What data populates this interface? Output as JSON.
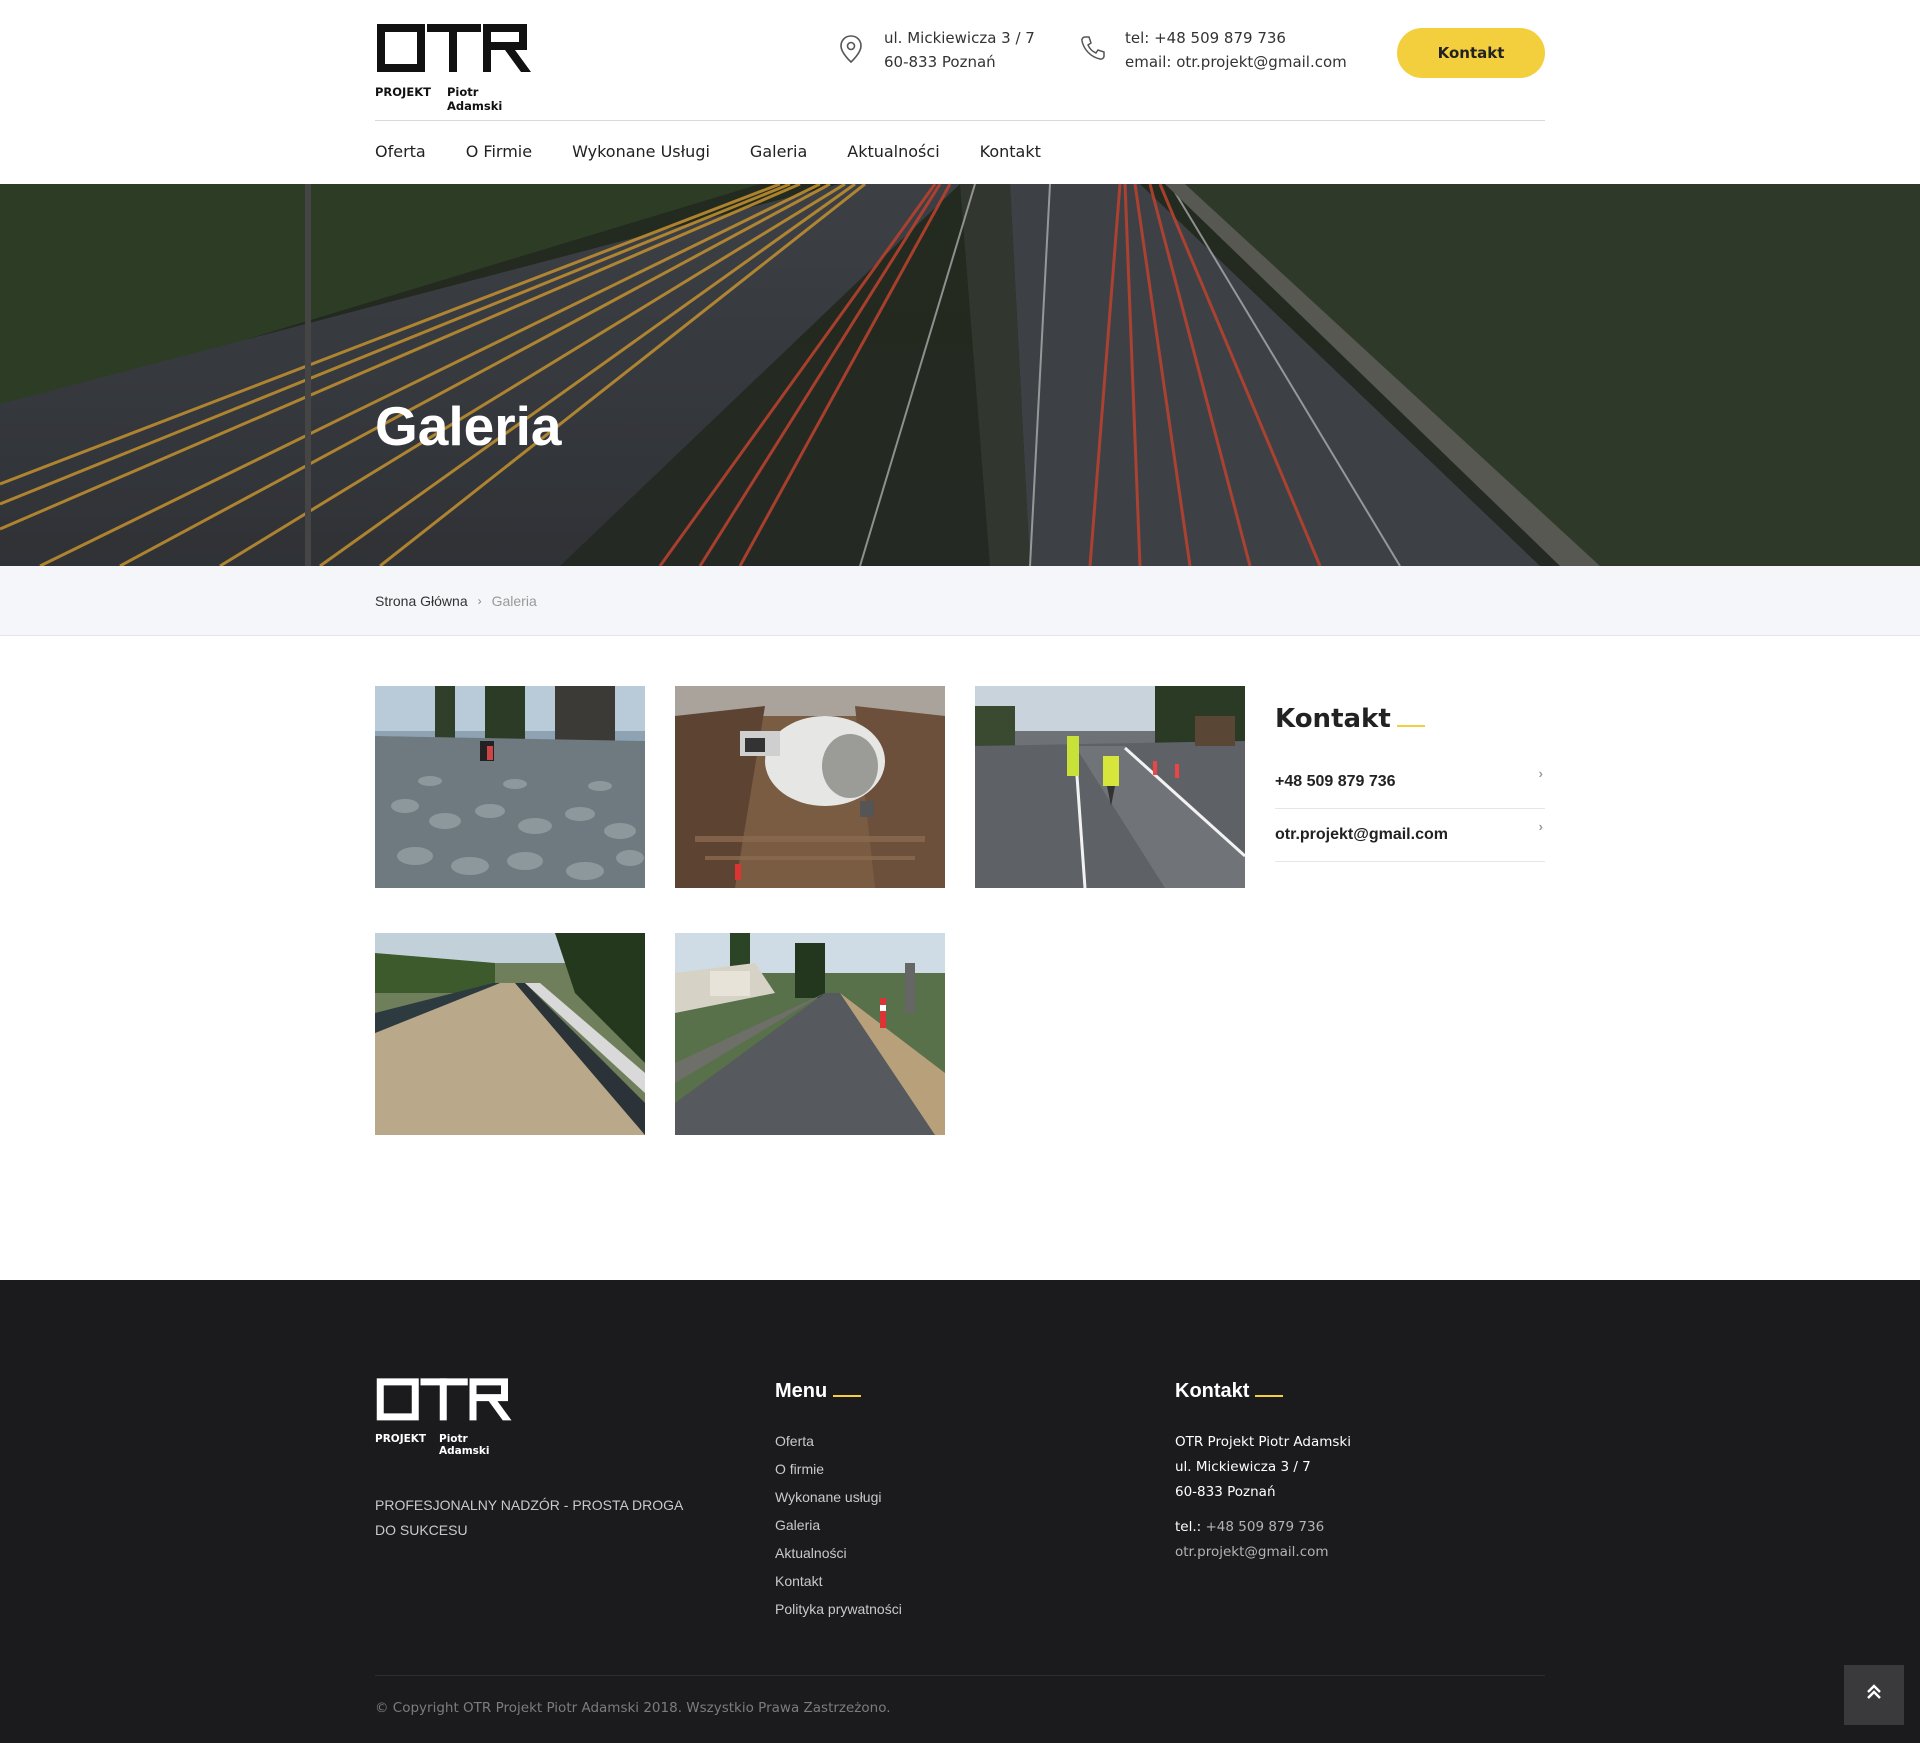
{
  "logo": {
    "mark": "OTR",
    "left": "PROJEKT",
    "right": "Piotr Adamski"
  },
  "header": {
    "address_line1": "ul. Mickiewicza 3 / 7",
    "address_line2": "60-833 Poznań",
    "phone_line": "tel: +48 509 879 736",
    "email_line": "email: otr.projekt@gmail.com",
    "cta_label": "Kontakt",
    "location_icon": "map-pin-icon",
    "phone_icon": "phone-icon",
    "accent": "#f4cf3d"
  },
  "nav": {
    "items": [
      "Oferta",
      "O Firmie",
      "Wykonane Usługi",
      "Galeria",
      "Aktualności",
      "Kontakt"
    ]
  },
  "hero": {
    "title": "Galeria"
  },
  "breadcrumb": {
    "home": "Strona Główna",
    "current": "Galeria"
  },
  "gallery": {
    "images": [
      "cobblestone-road-photo",
      "excavation-pipe-photo",
      "road-workers-photo",
      "new-asphalt-road-photo",
      "paved-street-photo"
    ]
  },
  "sidebar": {
    "title": "Kontakt",
    "phone": "+48 509 879 736",
    "email": "otr.projekt@gmail.com"
  },
  "footer": {
    "slogan": "PROFESJONALNY NADZÓR - PROSTA DROGA DO SUKCESU",
    "menu_title": "Menu",
    "menu": [
      "Oferta",
      "O firmie",
      "Wykonane usługi",
      "Galeria",
      "Aktualności",
      "Kontakt",
      "Polityka prywatności"
    ],
    "contact_title": "Kontakt",
    "company": "OTR Projekt Piotr Adamski",
    "address_line1": "ul. Mickiewicza 3 / 7",
    "address_line2": "60-833 Poznań",
    "tel_label": "tel.:",
    "tel": "+48 509 879 736",
    "email": "otr.projekt@gmail.com",
    "copyright": "© Copyright OTR Projekt Piotr Adamski 2018. Wszystkio Prawa Zastrzeżono.",
    "to_top_icon": "double-chevron-up-icon",
    "background": "#1b1b1d"
  }
}
